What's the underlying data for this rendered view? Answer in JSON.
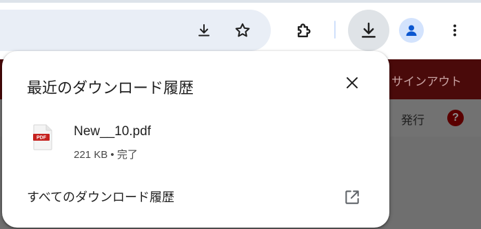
{
  "colors": {
    "site_header": "#4a0a0a",
    "page_dim": "#6f6f6f",
    "bubble_bg": "#ffffff",
    "pdf_badge": "#c5221f",
    "avatar_bg": "#d3e3fd",
    "avatar_fg": "#0b57d0"
  },
  "toolbar": {
    "omnibox_icons": [
      "download-icon",
      "star-icon"
    ],
    "buttons": [
      "extensions-icon",
      "download-icon",
      "profile-avatar",
      "more-vert-icon"
    ]
  },
  "webpage": {
    "signout": "サインアウト",
    "issue": "発行",
    "help": "?"
  },
  "bubble": {
    "title": "最近のダウンロード履歴",
    "item": {
      "file_name": "New__10.pdf",
      "badge": "PDF",
      "size": "221 KB",
      "separator": "•",
      "status": "完了"
    },
    "all_history_label": "すべてのダウンロード履歴"
  }
}
